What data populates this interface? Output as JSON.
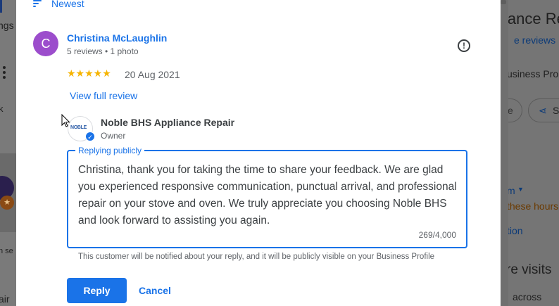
{
  "background": {
    "left": {
      "text_fragments": [
        "ngs",
        "k",
        "n se",
        "air"
      ]
    },
    "right": {
      "title_fragment": "iance Re",
      "reviews_link": "e reviews",
      "business_fragment": "usiness Pro",
      "share_fragment": "S",
      "pill_fragment": "e",
      "hours_dropdown": "m",
      "hours_note": "these hours",
      "action_fragment": "tion",
      "visits_fragment": "re visits",
      "across_fragment": "across"
    }
  },
  "sort": {
    "label": "Newest",
    "icon": "sort-icon"
  },
  "review": {
    "avatar_letter": "C",
    "reviewer_name": "Christina McLaughlin",
    "reviewer_meta": "5 reviews • 1 photo",
    "stars": "★★★★★",
    "rating": 5,
    "date": "20 Aug 2021",
    "view_full_review": "View full review",
    "report_icon": "report-icon"
  },
  "owner": {
    "logo_text": "NOBLE",
    "name": "Noble BHS Appliance Repair",
    "role": "Owner"
  },
  "reply": {
    "legend": "Replying publicly",
    "text": "Christina, thank you for taking the time to share your feedback. We are glad you experienced responsive communication, punctual arrival, and professional repair on your stove and oven. We truly appreciate you choosing Noble BHS and look forward to assisting you again.",
    "char_count": "269/4,000",
    "notice": "This customer will be notified about your reply, and it will be publicly visible on your Business Profile",
    "reply_button": "Reply",
    "cancel_button": "Cancel"
  },
  "colors": {
    "accent": "#1a73e8",
    "avatar": "#9c4dcc",
    "stars": "#f6b400"
  }
}
